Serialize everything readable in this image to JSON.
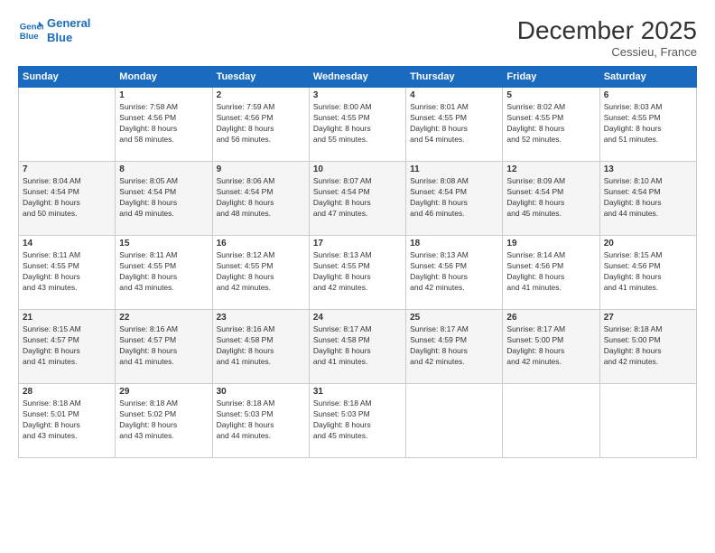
{
  "header": {
    "logo_line1": "General",
    "logo_line2": "Blue",
    "title": "December 2025",
    "location": "Cessieu, France"
  },
  "days_of_week": [
    "Sunday",
    "Monday",
    "Tuesday",
    "Wednesday",
    "Thursday",
    "Friday",
    "Saturday"
  ],
  "weeks": [
    [
      {
        "day": "",
        "info": ""
      },
      {
        "day": "1",
        "info": "Sunrise: 7:58 AM\nSunset: 4:56 PM\nDaylight: 8 hours\nand 58 minutes."
      },
      {
        "day": "2",
        "info": "Sunrise: 7:59 AM\nSunset: 4:56 PM\nDaylight: 8 hours\nand 56 minutes."
      },
      {
        "day": "3",
        "info": "Sunrise: 8:00 AM\nSunset: 4:55 PM\nDaylight: 8 hours\nand 55 minutes."
      },
      {
        "day": "4",
        "info": "Sunrise: 8:01 AM\nSunset: 4:55 PM\nDaylight: 8 hours\nand 54 minutes."
      },
      {
        "day": "5",
        "info": "Sunrise: 8:02 AM\nSunset: 4:55 PM\nDaylight: 8 hours\nand 52 minutes."
      },
      {
        "day": "6",
        "info": "Sunrise: 8:03 AM\nSunset: 4:55 PM\nDaylight: 8 hours\nand 51 minutes."
      }
    ],
    [
      {
        "day": "7",
        "info": "Sunrise: 8:04 AM\nSunset: 4:54 PM\nDaylight: 8 hours\nand 50 minutes."
      },
      {
        "day": "8",
        "info": "Sunrise: 8:05 AM\nSunset: 4:54 PM\nDaylight: 8 hours\nand 49 minutes."
      },
      {
        "day": "9",
        "info": "Sunrise: 8:06 AM\nSunset: 4:54 PM\nDaylight: 8 hours\nand 48 minutes."
      },
      {
        "day": "10",
        "info": "Sunrise: 8:07 AM\nSunset: 4:54 PM\nDaylight: 8 hours\nand 47 minutes."
      },
      {
        "day": "11",
        "info": "Sunrise: 8:08 AM\nSunset: 4:54 PM\nDaylight: 8 hours\nand 46 minutes."
      },
      {
        "day": "12",
        "info": "Sunrise: 8:09 AM\nSunset: 4:54 PM\nDaylight: 8 hours\nand 45 minutes."
      },
      {
        "day": "13",
        "info": "Sunrise: 8:10 AM\nSunset: 4:54 PM\nDaylight: 8 hours\nand 44 minutes."
      }
    ],
    [
      {
        "day": "14",
        "info": "Sunrise: 8:11 AM\nSunset: 4:55 PM\nDaylight: 8 hours\nand 43 minutes."
      },
      {
        "day": "15",
        "info": "Sunrise: 8:11 AM\nSunset: 4:55 PM\nDaylight: 8 hours\nand 43 minutes."
      },
      {
        "day": "16",
        "info": "Sunrise: 8:12 AM\nSunset: 4:55 PM\nDaylight: 8 hours\nand 42 minutes."
      },
      {
        "day": "17",
        "info": "Sunrise: 8:13 AM\nSunset: 4:55 PM\nDaylight: 8 hours\nand 42 minutes."
      },
      {
        "day": "18",
        "info": "Sunrise: 8:13 AM\nSunset: 4:56 PM\nDaylight: 8 hours\nand 42 minutes."
      },
      {
        "day": "19",
        "info": "Sunrise: 8:14 AM\nSunset: 4:56 PM\nDaylight: 8 hours\nand 41 minutes."
      },
      {
        "day": "20",
        "info": "Sunrise: 8:15 AM\nSunset: 4:56 PM\nDaylight: 8 hours\nand 41 minutes."
      }
    ],
    [
      {
        "day": "21",
        "info": "Sunrise: 8:15 AM\nSunset: 4:57 PM\nDaylight: 8 hours\nand 41 minutes."
      },
      {
        "day": "22",
        "info": "Sunrise: 8:16 AM\nSunset: 4:57 PM\nDaylight: 8 hours\nand 41 minutes."
      },
      {
        "day": "23",
        "info": "Sunrise: 8:16 AM\nSunset: 4:58 PM\nDaylight: 8 hours\nand 41 minutes."
      },
      {
        "day": "24",
        "info": "Sunrise: 8:17 AM\nSunset: 4:58 PM\nDaylight: 8 hours\nand 41 minutes."
      },
      {
        "day": "25",
        "info": "Sunrise: 8:17 AM\nSunset: 4:59 PM\nDaylight: 8 hours\nand 42 minutes."
      },
      {
        "day": "26",
        "info": "Sunrise: 8:17 AM\nSunset: 5:00 PM\nDaylight: 8 hours\nand 42 minutes."
      },
      {
        "day": "27",
        "info": "Sunrise: 8:18 AM\nSunset: 5:00 PM\nDaylight: 8 hours\nand 42 minutes."
      }
    ],
    [
      {
        "day": "28",
        "info": "Sunrise: 8:18 AM\nSunset: 5:01 PM\nDaylight: 8 hours\nand 43 minutes."
      },
      {
        "day": "29",
        "info": "Sunrise: 8:18 AM\nSunset: 5:02 PM\nDaylight: 8 hours\nand 43 minutes."
      },
      {
        "day": "30",
        "info": "Sunrise: 8:18 AM\nSunset: 5:03 PM\nDaylight: 8 hours\nand 44 minutes."
      },
      {
        "day": "31",
        "info": "Sunrise: 8:18 AM\nSunset: 5:03 PM\nDaylight: 8 hours\nand 45 minutes."
      },
      {
        "day": "",
        "info": ""
      },
      {
        "day": "",
        "info": ""
      },
      {
        "day": "",
        "info": ""
      }
    ]
  ]
}
